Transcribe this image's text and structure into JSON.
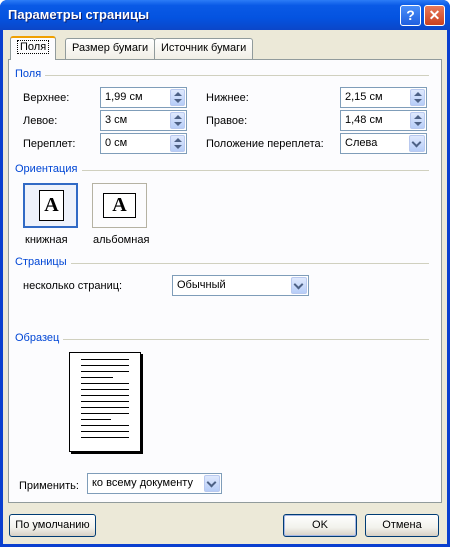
{
  "window": {
    "title": "Параметры страницы",
    "help_icon": "question-icon",
    "close_icon": "close-icon"
  },
  "tabs": [
    {
      "label": "Поля",
      "active": true
    },
    {
      "label": "Размер бумаги",
      "active": false
    },
    {
      "label": "Источник бумаги",
      "active": false
    }
  ],
  "margins": {
    "group_title": "Поля",
    "top_label": "Верхнее:",
    "top_value": "1,99 см",
    "bottom_label": "Нижнее:",
    "bottom_value": "2,15 см",
    "left_label": "Левое:",
    "left_value": "3 см",
    "right_label": "Правое:",
    "right_value": "1,48 см",
    "gutter_label": "Переплет:",
    "gutter_value": "0 см",
    "gutter_pos_label": "Положение переплета:",
    "gutter_pos_value": "Слева"
  },
  "orientation": {
    "group_title": "Ориентация",
    "portrait_label": "книжная",
    "landscape_label": "альбомная",
    "icon_letter": "A",
    "selected": "portrait"
  },
  "pages": {
    "group_title": "Страницы",
    "multiple_label": "несколько страниц:",
    "multiple_value": "Обычный"
  },
  "preview": {
    "group_title": "Образец",
    "apply_label": "Применить:",
    "apply_value": "ко всему документу"
  },
  "buttons": {
    "default_label": "По умолчанию",
    "ok_label": "OK",
    "cancel_label": "Отмена"
  },
  "colors": {
    "group_title": "#0046d5",
    "titlebar": "#0453e0",
    "dialog_bg": "#ece9d8"
  }
}
